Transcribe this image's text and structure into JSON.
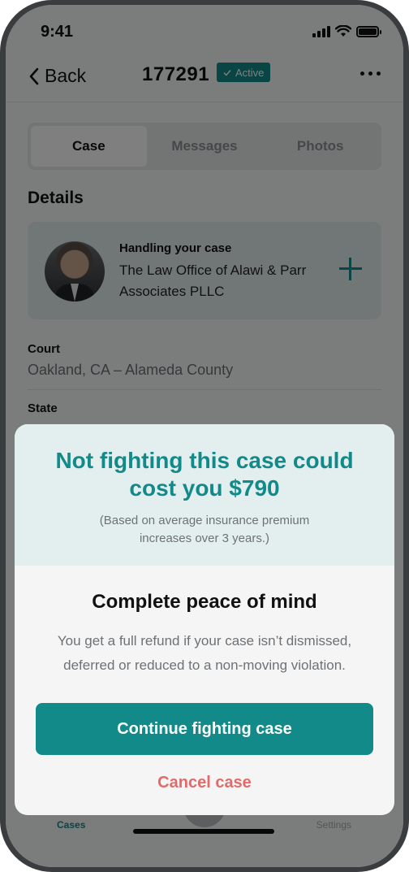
{
  "status_bar": {
    "time": "9:41"
  },
  "nav": {
    "back_label": "Back",
    "case_number": "177291",
    "status_badge": "Active",
    "icons": [
      "chevron-left-icon",
      "checkmark-icon",
      "more-icon"
    ]
  },
  "tabs": [
    {
      "label": "Case",
      "selected": true
    },
    {
      "label": "Messages",
      "selected": false
    },
    {
      "label": "Photos",
      "selected": false
    }
  ],
  "details": {
    "title": "Details",
    "handling_label": "Handling your case",
    "firm_name": "The Law Office of Alawi & Parr Associates PLLC",
    "court_label": "Court",
    "court_value": "Oakland, CA – Alameda County",
    "state_label": "State"
  },
  "tabbar": {
    "cases_label": "Cases",
    "settings_label": "Settings"
  },
  "modal": {
    "headline": "Not fighting this case could cost you $790",
    "note": "(Based on average insurance premium increases over 3 years.)",
    "title": "Complete peace of mind",
    "body": "You get a full refund if your case isn’t dismissed, deferred or reduced to a non-moving violation.",
    "primary_button": "Continue fighting case",
    "cancel_button": "Cancel case"
  },
  "colors": {
    "accent": "#128a8a",
    "accent_light": "#e3efee",
    "cancel": "#e46a6a"
  }
}
